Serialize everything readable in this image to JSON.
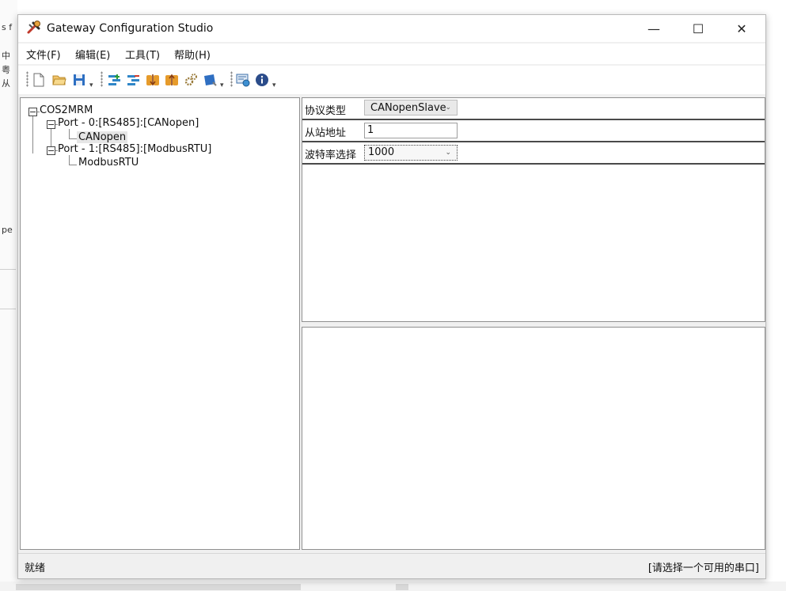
{
  "window": {
    "title": "Gateway Configuration Studio",
    "minimize_glyph": "—",
    "maximize_glyph": "☐",
    "close_glyph": "✕"
  },
  "menu": {
    "items": [
      "文件(F)",
      "编辑(E)",
      "工具(T)",
      "帮助(H)"
    ]
  },
  "toolbar": {
    "buttons": [
      "new-file-icon",
      "open-folder-icon",
      "save-icon",
      "add-port-icon",
      "remove-port-icon",
      "upload-config-icon",
      "download-config-icon",
      "settings-gear-icon",
      "device-icon",
      "monitor-icon",
      "info-icon"
    ],
    "dropdown_glyph": "▾"
  },
  "tree": {
    "root": "COS2MRM",
    "port0": "Port - 0:[RS485]:[CANopen]",
    "port0_child": "CANopen",
    "port1": "Port - 1:[RS485]:[ModbusRTU]",
    "port1_child": "ModbusRTU"
  },
  "properties": {
    "protocol_label": "协议类型",
    "protocol_value": "CANopenSlave",
    "slave_address_label": "从站地址",
    "slave_address_value": "1",
    "baud_rate_label": "波特率选择",
    "baud_rate_value": "1000",
    "arrow_glyph": "⌄"
  },
  "status": {
    "left": "就绪",
    "right": "[请选择一个可用的串口]"
  },
  "background": {
    "chars": [
      "s f",
      "中",
      "粤",
      "从",
      "pe"
    ]
  }
}
